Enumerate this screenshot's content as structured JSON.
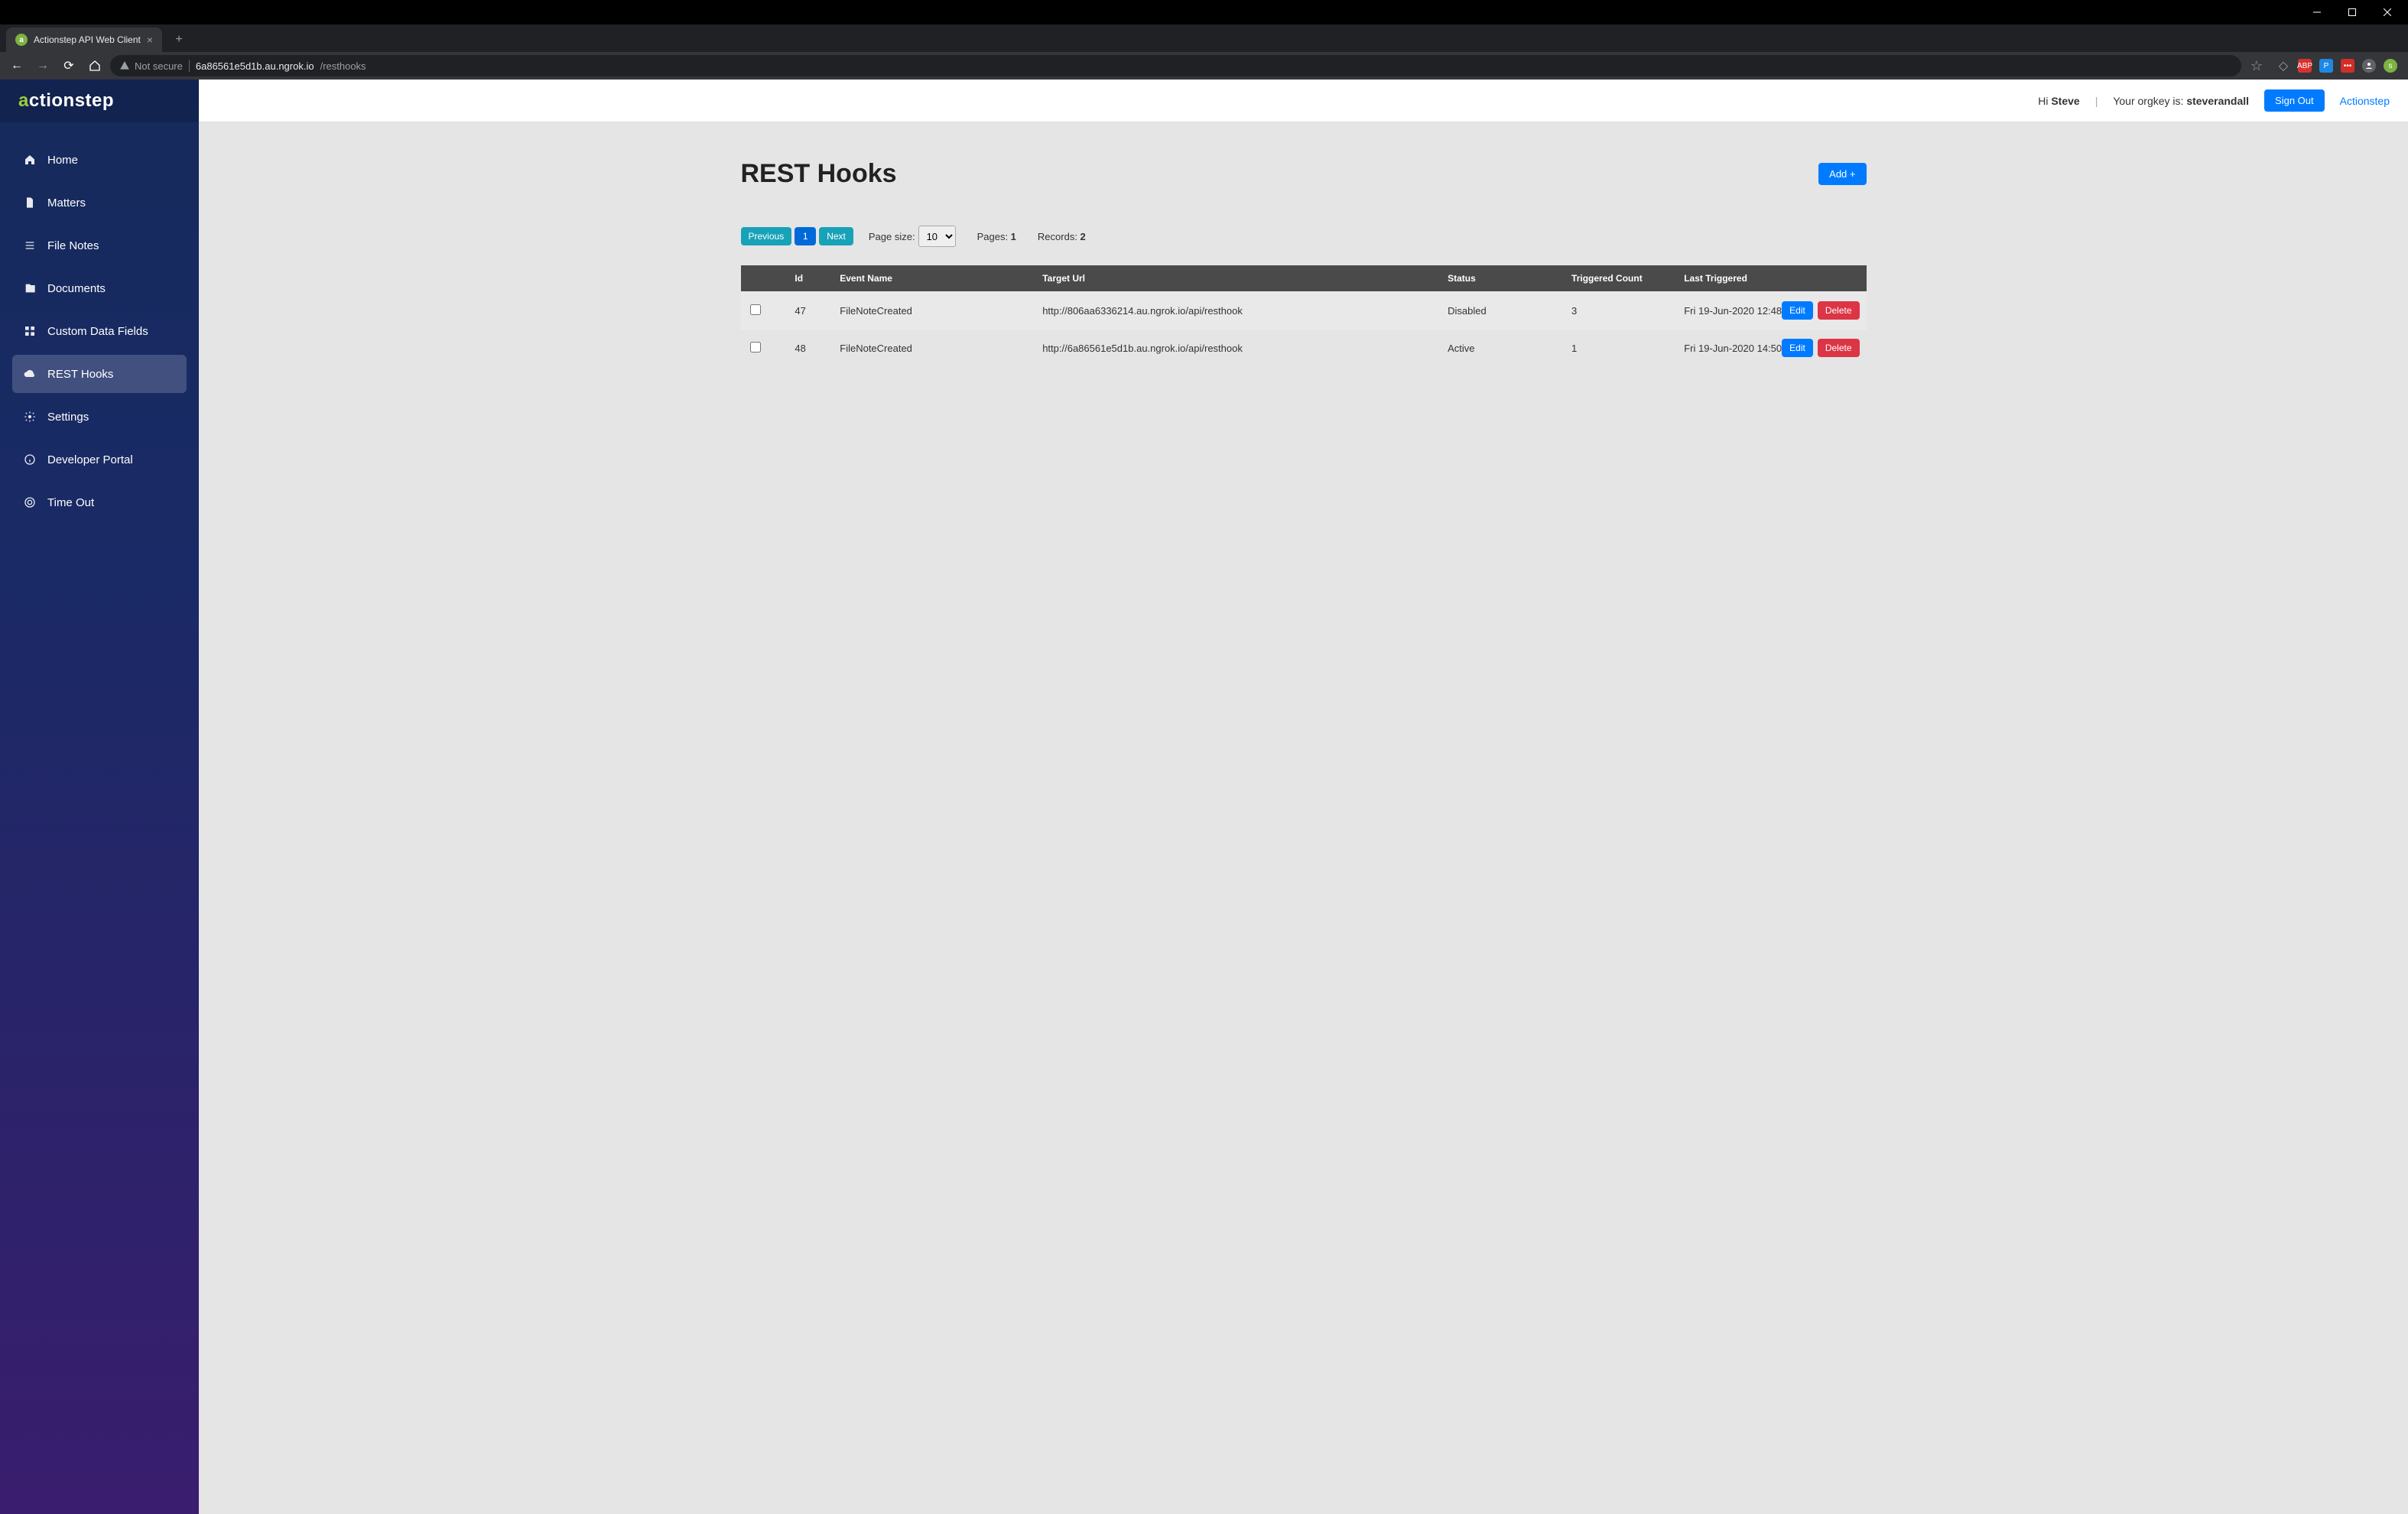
{
  "browser": {
    "tab_title": "Actionstep API Web Client",
    "not_secure_label": "Not secure",
    "url_host": "6a86561e5d1b.au.ngrok.io",
    "url_path": "/resthooks"
  },
  "logo": {
    "part1": "a",
    "part2": "ctionstep"
  },
  "sidebar": {
    "items": [
      {
        "label": "Home",
        "icon": "home-icon"
      },
      {
        "label": "Matters",
        "icon": "document-icon"
      },
      {
        "label": "File Notes",
        "icon": "list-icon"
      },
      {
        "label": "Documents",
        "icon": "files-icon"
      },
      {
        "label": "Custom Data Fields",
        "icon": "layout-icon"
      },
      {
        "label": "REST Hooks",
        "icon": "cloud-icon",
        "active": true
      },
      {
        "label": "Settings",
        "icon": "gear-icon"
      },
      {
        "label": "Developer Portal",
        "icon": "info-icon"
      },
      {
        "label": "Time Out",
        "icon": "target-icon"
      }
    ]
  },
  "topbar": {
    "greeting_prefix": "Hi ",
    "user_name": "Steve",
    "orgkey_prefix": "Your orgkey is: ",
    "orgkey": "steverandall",
    "signout_label": "Sign Out",
    "brand_link": "Actionstep"
  },
  "page": {
    "title": "REST Hooks",
    "add_label": "Add +"
  },
  "pager": {
    "prev_label": "Previous",
    "page_number": "1",
    "next_label": "Next",
    "page_size_label": "Page size:",
    "page_size_value": "10",
    "pages_label": "Pages: ",
    "pages_value": "1",
    "records_label": "Records: ",
    "records_value": "2"
  },
  "table": {
    "headers": {
      "id": "Id",
      "event": "Event Name",
      "url": "Target Url",
      "status": "Status",
      "count": "Triggered Count",
      "last": "Last Triggered"
    },
    "edit_label": "Edit",
    "delete_label": "Delete",
    "rows": [
      {
        "id": "47",
        "event": "FileNoteCreated",
        "url": "http://806aa6336214.au.ngrok.io/api/resthook",
        "status": "Disabled",
        "count": "3",
        "last": "Fri 19-Jun-2020 12:48"
      },
      {
        "id": "48",
        "event": "FileNoteCreated",
        "url": "http://6a86561e5d1b.au.ngrok.io/api/resthook",
        "status": "Active",
        "count": "1",
        "last": "Fri 19-Jun-2020 14:50"
      }
    ]
  }
}
